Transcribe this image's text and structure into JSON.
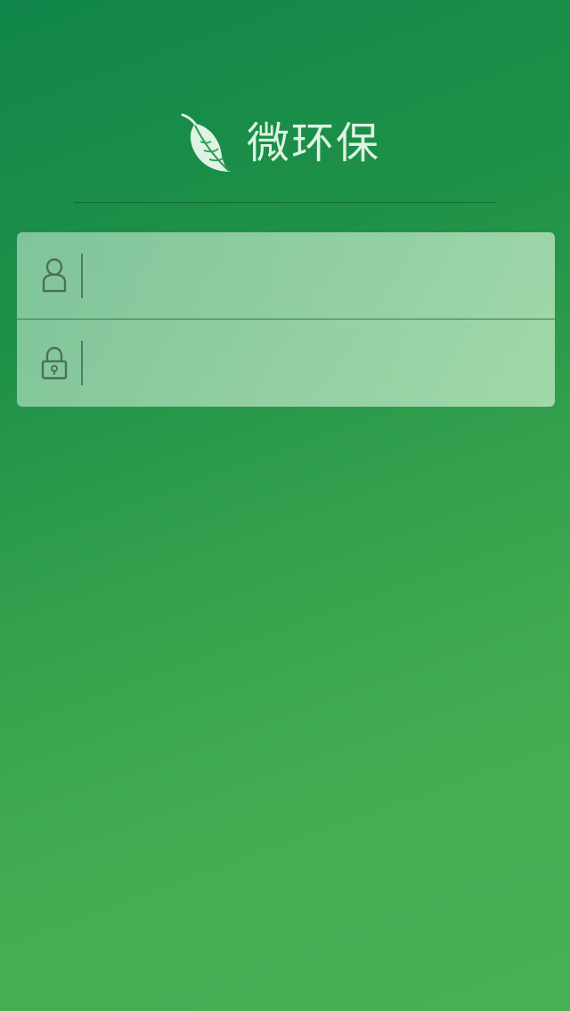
{
  "app": {
    "name": "微环保",
    "logo_icon": "leaf-icon"
  },
  "login_form": {
    "username": {
      "icon": "user-icon",
      "value": "",
      "placeholder": ""
    },
    "password": {
      "icon": "lock-icon",
      "value": "",
      "placeholder": ""
    }
  },
  "colors": {
    "background_top": "#11864a",
    "background_bottom": "#47b055",
    "logo_text": "#dff3e3",
    "icon_stroke": "#4f6f58"
  }
}
